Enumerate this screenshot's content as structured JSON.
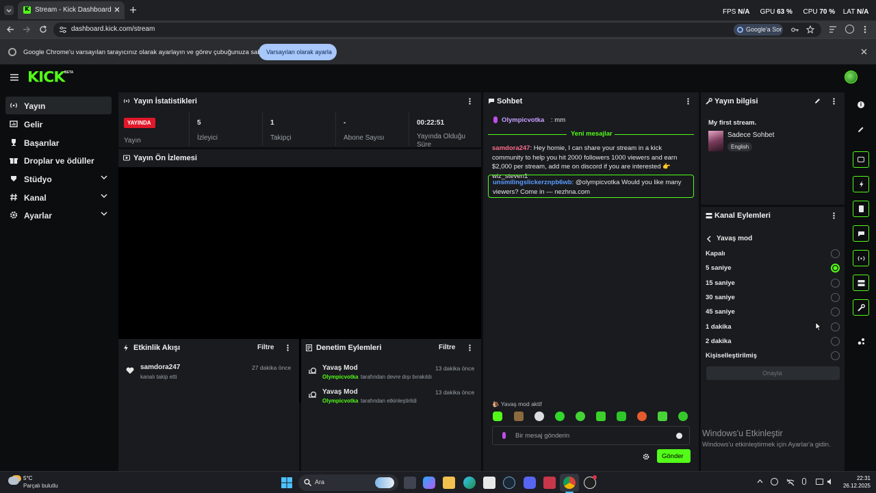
{
  "browser": {
    "tab_title": "Stream - Kick Dashboard",
    "url": "dashboard.kick.com/stream",
    "google_ask": "Google'a Sor",
    "overlay": {
      "fps_label": "FPS",
      "fps_value": "N/A",
      "gpu_label": "GPU",
      "gpu_value": "63 %",
      "cpu_label": "CPU",
      "cpu_value": "70 %",
      "lat_label": "LAT",
      "lat_value": "N/A"
    },
    "infobar_text": "Google Chrome'u varsayılan tarayıcınız olarak ayarlayın ve görev çubuğunuza sabitleyin",
    "infobar_button": "Varsayılan olarak ayarla"
  },
  "kick": {
    "logo": "KICK",
    "logo_badge": "BETA",
    "sidebar": [
      {
        "label": "Yayın",
        "icon": "broadcast-icon"
      },
      {
        "label": "Gelir",
        "icon": "revenue-icon"
      },
      {
        "label": "Başarılar",
        "icon": "trophy-icon"
      },
      {
        "label": "Droplar ve ödüller",
        "icon": "gift-icon"
      },
      {
        "label": "Stüdyo",
        "icon": "studio-icon"
      },
      {
        "label": "Kanal",
        "icon": "channel-icon"
      },
      {
        "label": "Ayarlar",
        "icon": "gear-icon"
      }
    ]
  },
  "stats": {
    "title": "Yayın İstatistikleri",
    "live_badge": "YAYINDA",
    "live_label": "Yayın",
    "viewers_value": "5",
    "viewers_label": "İzleyici",
    "followers_value": "1",
    "followers_label": "Takipçi",
    "subs_value": "-",
    "subs_label": "Abone Sayısı",
    "uptime_value": "00:22:51",
    "uptime_label": "Yayında Olduğu Süre"
  },
  "preview": {
    "title": "Yayın Ön İzlemesi"
  },
  "activity": {
    "title": "Etkinlik Akışı",
    "filter": "Filtre",
    "items": [
      {
        "user": "samdora247",
        "action": "kanalı takip etti",
        "time": "27 dakika önce"
      }
    ]
  },
  "mod": {
    "title": "Denetim Eylemleri",
    "filter": "Filtre",
    "items": [
      {
        "title": "Yavaş Mod",
        "user": "Olympicvotka",
        "action": "tarafından devre dışı bırakıldı",
        "time": "13 dakika önce"
      },
      {
        "title": "Yavaş Mod",
        "user": "Olympicvotka",
        "action": "tarafından etkinleştirildi",
        "time": "13 dakika önce"
      }
    ]
  },
  "chat": {
    "title": "Sohbet",
    "first": {
      "user": "Olympicvotka",
      "text": ": mm"
    },
    "new_messages": "Yeni mesajlar",
    "msg1_user": "samdora247",
    "msg1_text": ": Hey homie, I can share your stream in a kick community to help you hit 2000 followers 1000 viewers and earn $2,000 per stream, add me on discord if you are interested 👉 wiz_steven1",
    "msg2_user": "unsmilingslickerznpb6wb",
    "msg2_text": ": @olympicvotka Would you like many viewers? Come in — nezhna.com",
    "slow_mode": "Yavaş mod aktif",
    "placeholder": "Bir mesaj gönderin",
    "send": "Gönder"
  },
  "stream_info": {
    "title": "Yayın bilgisi",
    "stream_title": "My first stream.",
    "category": "Sadece Sohbet",
    "language": "English"
  },
  "channel_actions": {
    "title": "Kanal Eylemleri",
    "back_label": "Yavaş mod",
    "options": [
      "Kapalı",
      "5 saniye",
      "15 saniye",
      "30 saniye",
      "45 saniye",
      "1 dakika",
      "2 dakika",
      "Kişiselleştirilmiş"
    ],
    "selected": "5 saniye",
    "confirm": "Onayla"
  },
  "watermark": {
    "line1": "Windows'u Etkinleştir",
    "line2": "Windows'u etkinleştirmek için Ayarlar'a gidin."
  },
  "taskbar": {
    "temp": "5°C",
    "weather": "Parçalı bulutlu",
    "search": "Ara",
    "time": "22:31",
    "date": "26.12.2025"
  },
  "colors": {
    "accent": "#53fc18",
    "live": "#e0182a",
    "panel": "#191b1f"
  }
}
